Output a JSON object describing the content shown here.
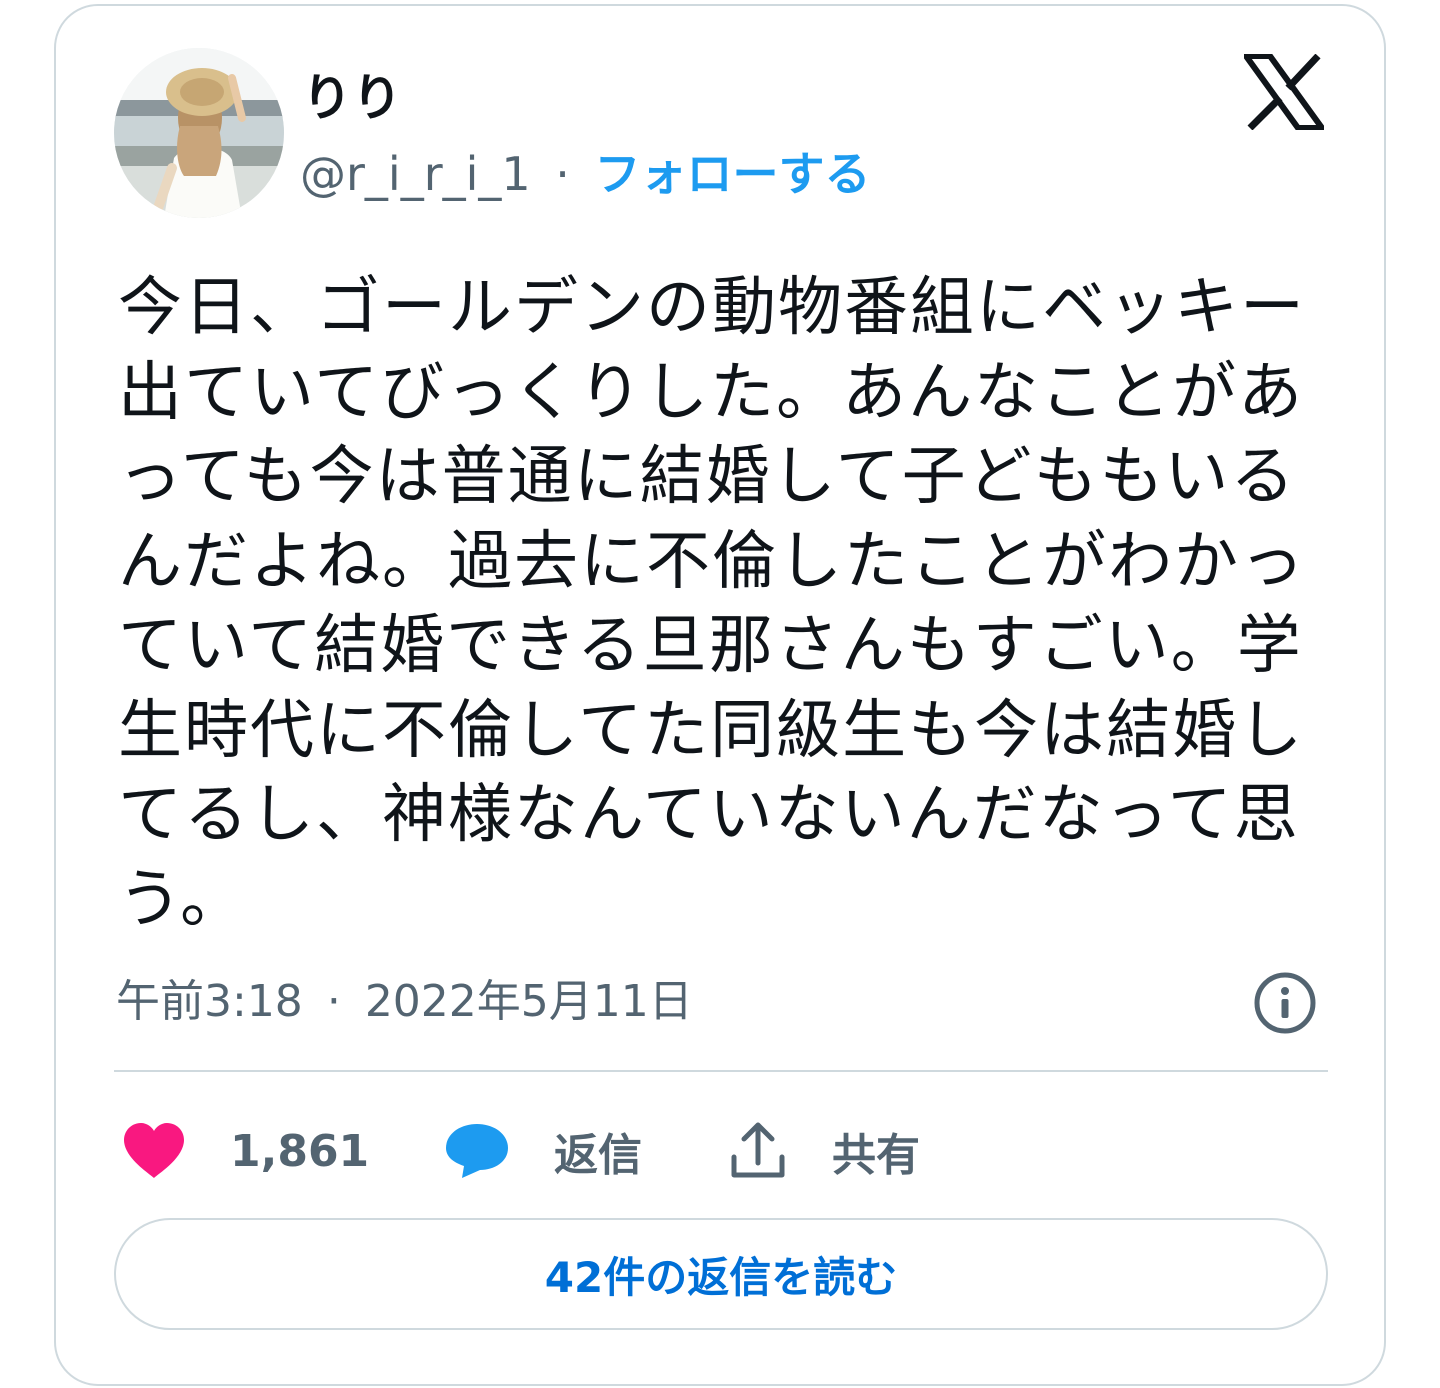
{
  "user": {
    "display_name": "りり",
    "handle": "@r_i_r_i_1",
    "separator": "·",
    "follow_label": "フォローする"
  },
  "tweet": {
    "text": "今日、ゴールデンの動物番組にベッキー出ていてびっくりした。あんなことがあっても今は普通に結婚して子どももいるんだよね。過去に不倫したことがわかっていて結婚できる旦那さんもすごい。学生時代に不倫してた同級生も今は結婚してるし、神様なんていないんだなって思う。",
    "time": "午前3:18",
    "meta_separator": "·",
    "date": "2022年5月11日"
  },
  "actions": {
    "like_count": "1,861",
    "reply_label": "返信",
    "share_label": "共有"
  },
  "read_replies_label": "42件の返信を読む",
  "icons": {
    "logo": "x-logo-icon",
    "info": "info-icon",
    "like": "heart-icon",
    "reply": "speech-bubble-icon",
    "share": "share-upload-icon"
  },
  "colors": {
    "accent_blue": "#1d9bf0",
    "link_blue": "#006fd6",
    "like_pink": "#f91880",
    "muted_text": "#536471",
    "border": "#cfd9de"
  }
}
